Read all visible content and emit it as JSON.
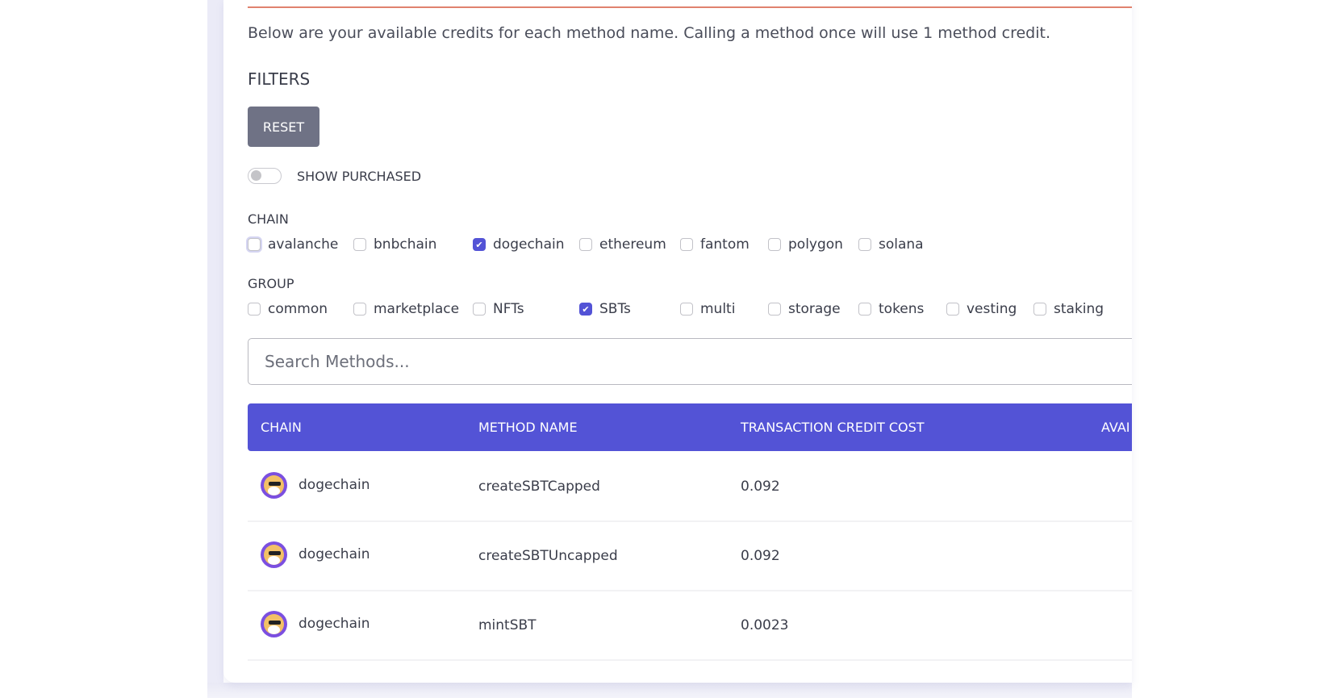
{
  "description": "Below are your available credits for each method name. Calling a method once will use 1 method credit.",
  "filters": {
    "title": "FILTERS",
    "reset_label": "RESET",
    "show_purchased_label": "SHOW PURCHASED",
    "show_purchased_on": false,
    "chain_label": "CHAIN",
    "chains": [
      {
        "label": "avalanche",
        "checked": false
      },
      {
        "label": "bnbchain",
        "checked": false
      },
      {
        "label": "dogechain",
        "checked": true
      },
      {
        "label": "ethereum",
        "checked": false
      },
      {
        "label": "fantom",
        "checked": false
      },
      {
        "label": "polygon",
        "checked": false
      },
      {
        "label": "solana",
        "checked": false
      }
    ],
    "group_label": "GROUP",
    "groups": [
      {
        "label": "common",
        "checked": false
      },
      {
        "label": "marketplace",
        "checked": false
      },
      {
        "label": "NFTs",
        "checked": false
      },
      {
        "label": "SBTs",
        "checked": true
      },
      {
        "label": "multi",
        "checked": false
      },
      {
        "label": "storage",
        "checked": false
      },
      {
        "label": "tokens",
        "checked": false
      },
      {
        "label": "vesting",
        "checked": false
      },
      {
        "label": "staking",
        "checked": false
      }
    ]
  },
  "search": {
    "placeholder": "Search Methods...",
    "value": ""
  },
  "table": {
    "headers": [
      "CHAIN",
      "METHOD NAME",
      "TRANSACTION CREDIT COST",
      "AVAI"
    ],
    "rows": [
      {
        "chain": "dogechain",
        "method": "createSBTCapped",
        "cost": "0.092"
      },
      {
        "chain": "dogechain",
        "method": "createSBTUncapped",
        "cost": "0.092"
      },
      {
        "chain": "dogechain",
        "method": "mintSBT",
        "cost": "0.0023"
      }
    ]
  },
  "colors": {
    "accent": "#5353d6",
    "reset": "#6f7285",
    "divider": "#e0826e"
  }
}
